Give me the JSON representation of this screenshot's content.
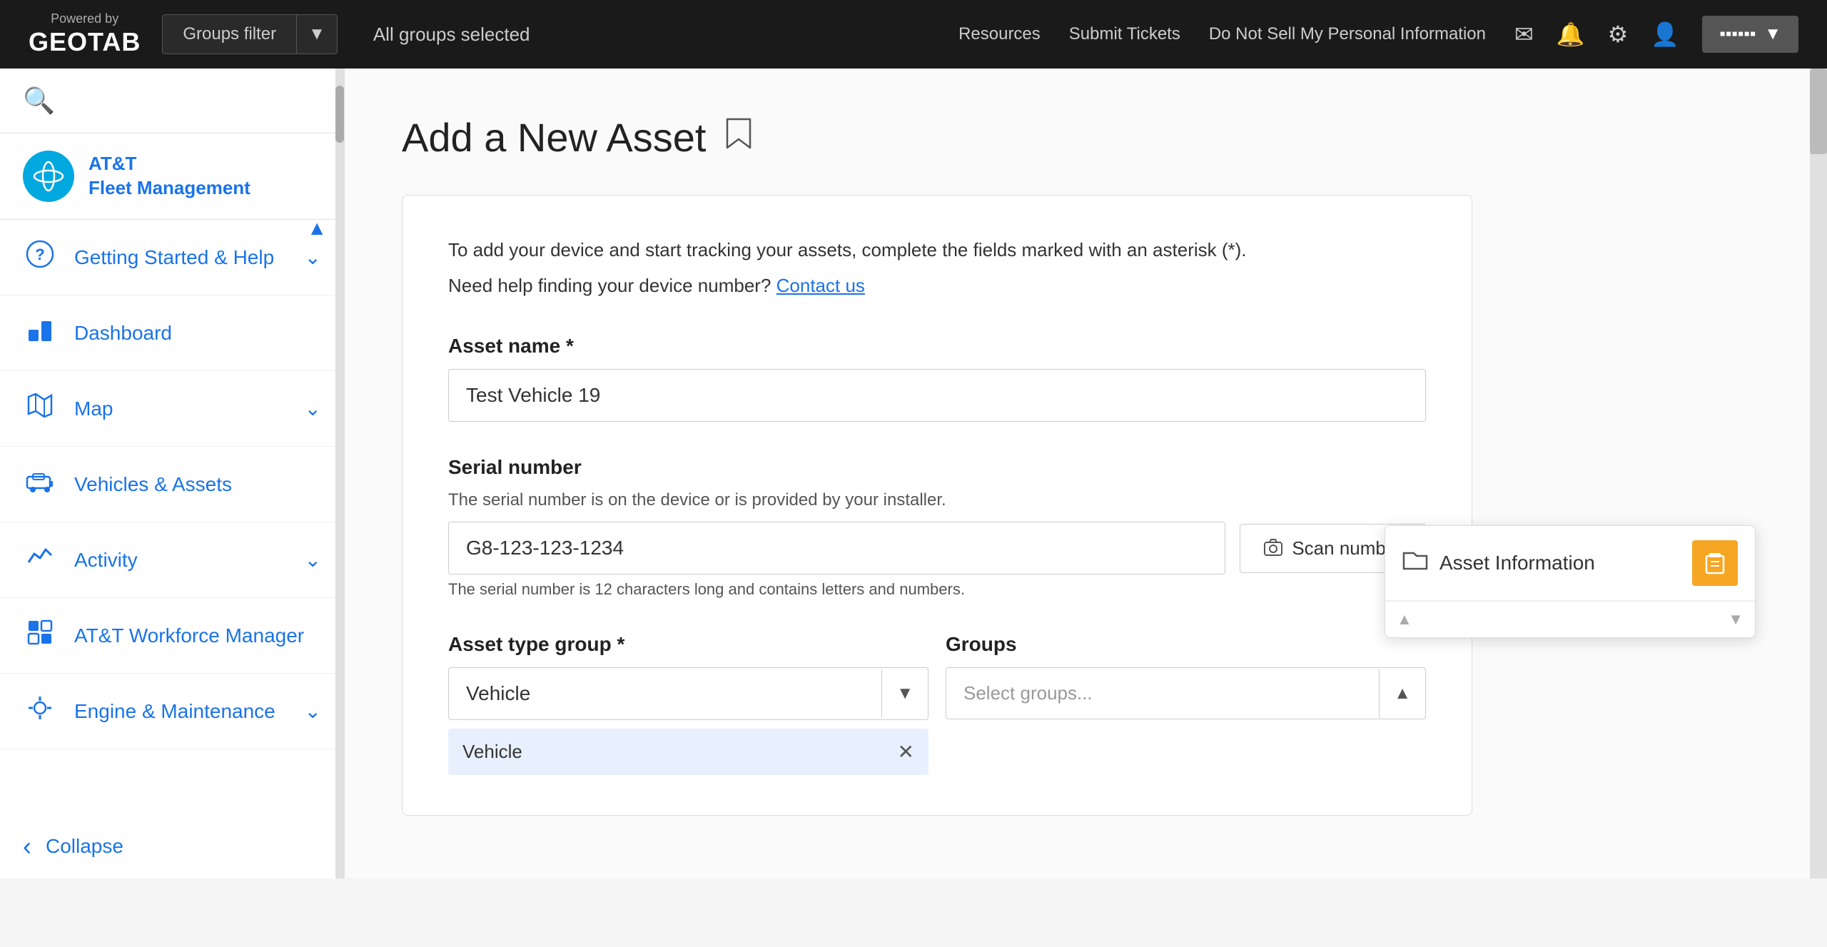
{
  "topbar": {
    "powered_by": "Powered by",
    "brand": "GEOTAB",
    "nav_links": [
      "Resources",
      "Submit Tickets",
      "Do Not Sell My Personal Information"
    ],
    "groups_filter_label": "Groups filter",
    "all_groups_selected": "All groups selected",
    "icons": {
      "mail": "✉",
      "bell": "🔔",
      "gear": "⚙",
      "user": "👤"
    }
  },
  "sidebar": {
    "logo_text": "AT&T\nFleet Management",
    "logo_initials": "AT&T",
    "nav_items": [
      {
        "id": "getting-started",
        "label": "Getting Started & Help",
        "icon": "?",
        "has_chevron": true
      },
      {
        "id": "dashboard",
        "label": "Dashboard",
        "icon": "📊",
        "has_chevron": false
      },
      {
        "id": "map",
        "label": "Map",
        "icon": "🗺",
        "has_chevron": true
      },
      {
        "id": "vehicles",
        "label": "Vehicles & Assets",
        "icon": "🚛",
        "has_chevron": false
      },
      {
        "id": "activity",
        "label": "Activity",
        "icon": "📈",
        "has_chevron": true
      },
      {
        "id": "att-workforce",
        "label": "AT&T Workforce Manager",
        "icon": "🧩",
        "has_chevron": false
      },
      {
        "id": "engine",
        "label": "Engine & Maintenance",
        "icon": "🔧",
        "has_chevron": true
      }
    ],
    "collapse_label": "Collapse"
  },
  "page": {
    "title": "Add a New Asset",
    "description_line1": "To add your device and start tracking your assets, complete the fields marked with an asterisk (*).",
    "description_line2": "Need help finding your device number?",
    "contact_link": "Contact us",
    "asset_name_label": "Asset name *",
    "asset_name_value": "Test Vehicle 19",
    "asset_name_placeholder": "Test Vehicle 19",
    "serial_number_label": "Serial number",
    "serial_desc": "The serial number is on the device or is provided by your installer.",
    "serial_value": "G8-123-123-1234",
    "serial_hint": "The serial number is 12 characters long and contains letters and numbers.",
    "scan_number_label": "Scan number",
    "asset_type_label": "Asset type group *",
    "asset_type_value": "Vehicle",
    "groups_label": "Groups",
    "groups_placeholder": "Select groups...",
    "vehicle_chip": "Vehicle",
    "popup": {
      "title": "Asset Information",
      "folder_icon": "📁",
      "orange_icon": "📋"
    }
  }
}
